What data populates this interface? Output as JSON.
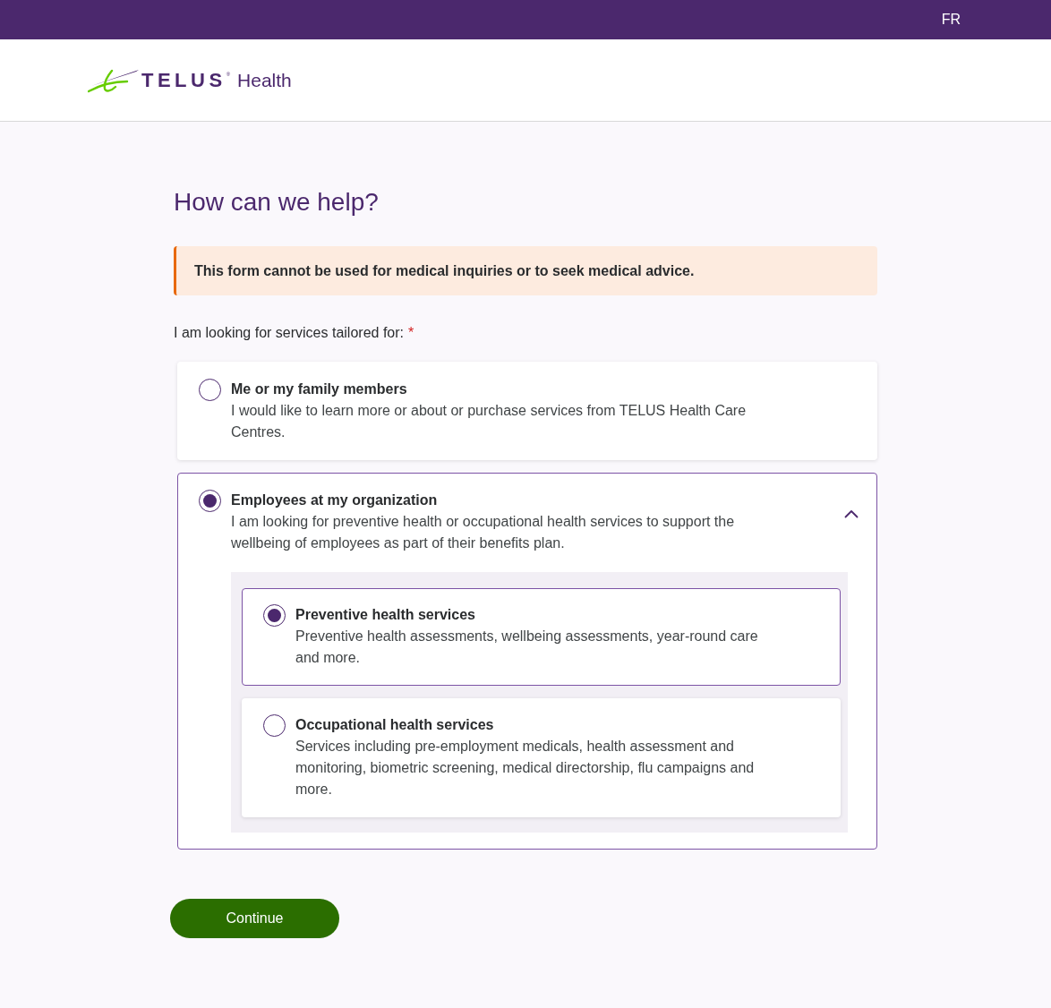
{
  "top_bar": {
    "language_link": "FR"
  },
  "header": {
    "logo": {
      "wordmark": "TELUS",
      "registered_mark": "®",
      "product": "Health"
    }
  },
  "page": {
    "title": "How can we help?"
  },
  "alert": {
    "text": "This form cannot be used for medical inquiries or to seek medical advice."
  },
  "question": {
    "label": "I am looking for services tailored for:",
    "required_mark": "*",
    "options": [
      {
        "title": "Me or my family members",
        "description": "I would like to learn more or about or purchase services from TELUS Health Care Centres.",
        "selected": false
      },
      {
        "title": "Employees at my organization",
        "description": "I am looking for preventive health or occupational health services to support the wellbeing of employees as part of their benefits plan.",
        "selected": true,
        "expanded": true,
        "sub_options": [
          {
            "title": "Preventive health services",
            "description": "Preventive health assessments, wellbeing assessments, year-round care and more.",
            "selected": true
          },
          {
            "title": "Occupational health services",
            "description": "Services including pre-employment medicals, health assessment and monitoring, biometric screening, medical directorship, flu campaigns and more.",
            "selected": false
          }
        ]
      }
    ]
  },
  "actions": {
    "continue_button": "Continue"
  }
}
